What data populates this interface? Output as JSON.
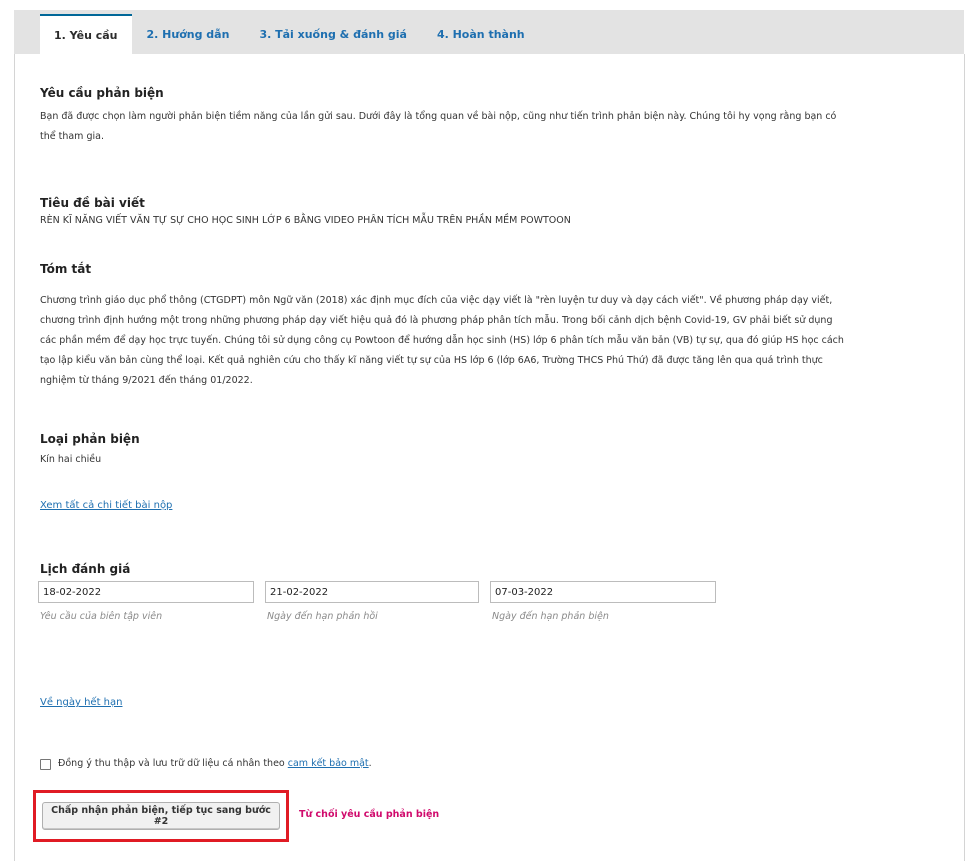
{
  "tabs": [
    {
      "label": "1. Yêu cầu",
      "active": true
    },
    {
      "label": "2. Hướng dẫn",
      "active": false
    },
    {
      "label": "3. Tải xuống & đánh giá",
      "active": false
    },
    {
      "label": "4. Hoàn thành",
      "active": false
    }
  ],
  "request": {
    "heading": "Yêu cầu phản biện",
    "text_line1": "Bạn đã được chọn làm người phản biện tiềm năng của lần gửi sau. Dưới đây là tổng quan về bài nộp, cũng như tiến trình phản biện này. Chúng tôi hy vọng rằng bạn có",
    "text_line2": "thể tham gia."
  },
  "article": {
    "title_heading": "Tiêu đề bài viết",
    "title": "RÈN KĨ NĂNG VIẾT VĂN TỰ SỰ CHO HỌC SINH LỚP 6 BẰNG VIDEO PHÂN TÍCH MẪU TRÊN PHẦN MỀM POWTOON",
    "abstract_heading": "Tóm tắt",
    "abstract_lines": [
      "Chương trình giáo dục phổ thông (CTGDPT) môn Ngữ văn (2018) xác định mục đích của việc dạy viết là \"rèn luyện tư duy và dạy cách viết\". Về phương pháp dạy viết,",
      "chương trình định hướng một trong những phương pháp dạy viết hiệu quả đó là phương pháp phân tích mẫu. Trong bối cảnh dịch bệnh Covid-19, GV phải biết sử dụng",
      "các phần mềm để dạy học trực tuyến. Chúng tôi sử dụng công cụ Powtoon để hướng dẫn học sinh (HS) lớp 6 phân tích mẫu văn bản (VB) tự sự, qua đó giúp HS học cách",
      "tạo lập kiểu văn bản cùng thể loại. Kết quả nghiên cứu cho thấy kĩ năng viết  tự sự của HS lớp 6 (lớp 6A6, Trường THCS Phú Thứ) đã được tăng lên qua quá trình thực",
      "nghiệm từ tháng 9/2021 đến tháng 01/2022."
    ]
  },
  "review_type": {
    "heading": "Loại phản biện",
    "value": "Kín hai chiều"
  },
  "view_details_link": "Xem tất cả chi tiết bài nộp",
  "schedule": {
    "heading": "Lịch đánh giá",
    "dates": [
      {
        "value": "18-02-2022",
        "desc": "Yêu cầu của biên tập viên"
      },
      {
        "value": "21-02-2022",
        "desc": "Ngày đến hạn phản hồi"
      },
      {
        "value": "07-03-2022",
        "desc": "Ngày đến hạn phản biện"
      }
    ]
  },
  "deadlines_link": "Về ngày hết hạn",
  "consent": {
    "text": "Đồng ý thu thập và lưu trữ dữ liệu cá nhân theo",
    "link": "cam kết bảo mật",
    "suffix": ".",
    "checked": false
  },
  "actions": {
    "accept_label": "Chấp nhận phản biện, tiếp tục sang bước #2",
    "decline_label": "Từ chối yêu cầu phản biện"
  },
  "colors": {
    "link": "#1e6fb0",
    "decline": "#d00a6c",
    "highlight": "#e01b24",
    "active_tab_border": "#006798"
  }
}
